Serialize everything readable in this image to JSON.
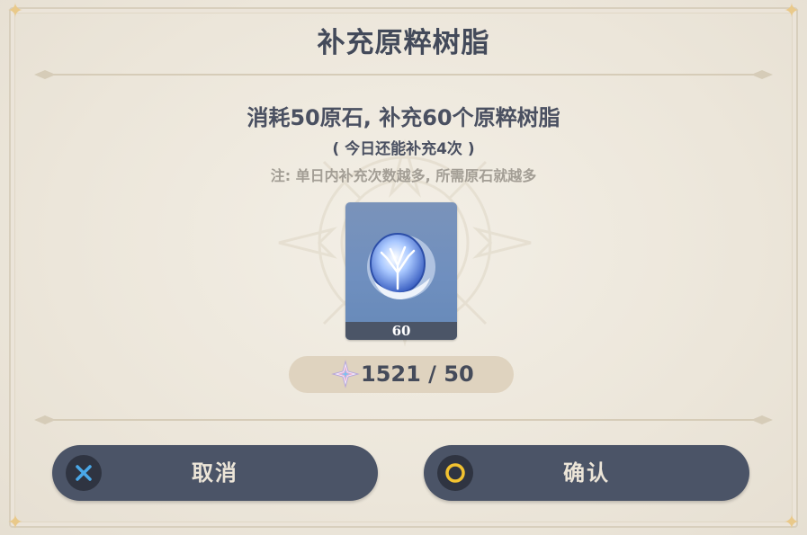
{
  "dialog": {
    "title": "补充原粹树脂",
    "main_text": "消耗50原石, 补充60个原粹树脂",
    "sub_text": "( 今日还能补充4次 )",
    "note_text": "注: 单日内补充次数越多, 所需原石就越多"
  },
  "item": {
    "icon": "original-resin-icon",
    "count": "60"
  },
  "cost": {
    "icon": "primogem-icon",
    "text": "1521 / 50"
  },
  "buttons": {
    "cancel_label": "取消",
    "cancel_icon": "cross-button-icon",
    "confirm_label": "确认",
    "confirm_icon": "circle-button-icon"
  },
  "colors": {
    "background": "#ece6da",
    "text_dark": "#434a5a",
    "note_gray": "#a39e95",
    "button_bg": "#4b5467",
    "cancel_accent": "#4aa8e8",
    "confirm_accent": "#f2c230"
  }
}
